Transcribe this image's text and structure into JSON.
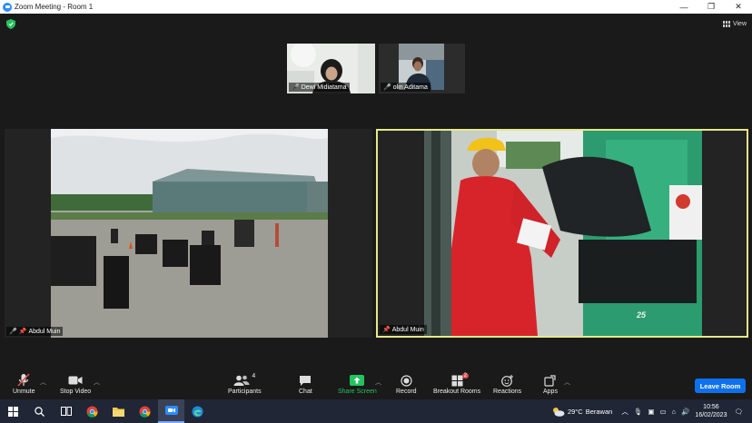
{
  "window": {
    "title": "Zoom Meeting - Room 1",
    "minimize": "—",
    "maximize": "❐",
    "close": "✕"
  },
  "top": {
    "view_label": "View"
  },
  "thumbnails": [
    {
      "name": "Dewi Midiatama"
    },
    {
      "name": "olin Aditama"
    }
  ],
  "tiles": [
    {
      "name": "Abdul Muin"
    },
    {
      "name": "Abdul Muin"
    }
  ],
  "toolbar": {
    "unmute": "Unmute",
    "stop_video": "Stop Video",
    "participants": "Participants",
    "participants_count": "4",
    "chat": "Chat",
    "share_screen": "Share Screen",
    "record": "Record",
    "breakout_rooms": "Breakout Rooms",
    "breakout_badge": "2",
    "reactions": "Reactions",
    "apps": "Apps",
    "leave": "Leave Room"
  },
  "forklift_text": "25",
  "taskbar": {
    "weather_temp": "29°C",
    "weather_desc": "Berawan",
    "time": "10:56",
    "date": "16/02/2023"
  },
  "colors": {
    "accent": "#0e71eb",
    "share_green": "#23c35f",
    "active_border": "#e6e98a",
    "muted_red": "#e24a4a"
  }
}
